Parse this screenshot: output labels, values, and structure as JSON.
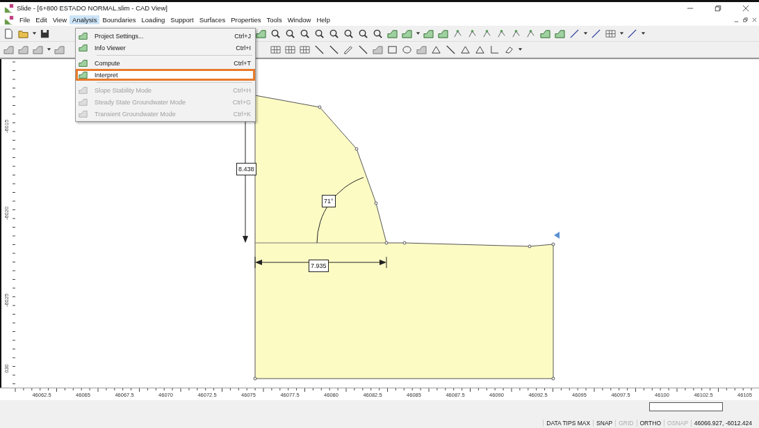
{
  "window": {
    "title": "Slide - [6+800 ESTADO NORMAL.slim - CAD View]"
  },
  "menu_bar": [
    {
      "label": "File",
      "selected": false
    },
    {
      "label": "Edit",
      "selected": false
    },
    {
      "label": "View",
      "selected": false
    },
    {
      "label": "Analysis",
      "selected": true
    },
    {
      "label": "Boundaries",
      "selected": false
    },
    {
      "label": "Loading",
      "selected": false
    },
    {
      "label": "Support",
      "selected": false
    },
    {
      "label": "Surfaces",
      "selected": false
    },
    {
      "label": "Properties",
      "selected": false
    },
    {
      "label": "Tools",
      "selected": false
    },
    {
      "label": "Window",
      "selected": false
    },
    {
      "label": "Help",
      "selected": false
    }
  ],
  "analysis_menu": [
    {
      "label": "Project Settings...",
      "shortcut": "Ctrl+J",
      "disabled": false,
      "highlighted": false,
      "separator_after": false
    },
    {
      "label": "Info Viewer",
      "shortcut": "Ctrl+I",
      "disabled": false,
      "highlighted": false,
      "separator_after": true
    },
    {
      "label": "Compute",
      "shortcut": "Ctrl+T",
      "disabled": false,
      "highlighted": false,
      "separator_after": false
    },
    {
      "label": "Interpret",
      "disabled": false,
      "highlighted": true,
      "separator_after": true
    },
    {
      "label": "Slope Stability Mode",
      "shortcut": "Ctrl+H",
      "disabled": true,
      "highlighted": false,
      "separator_after": false
    },
    {
      "label": "Steady State Groundwater Mode",
      "shortcut": "Ctrl+G",
      "disabled": true,
      "highlighted": false,
      "separator_after": false
    },
    {
      "label": "Transient Groundwater Mode",
      "shortcut": "Ctrl+K",
      "disabled": true,
      "highlighted": false,
      "separator_after": false
    }
  ],
  "canvas": {
    "height_dimension": "8.438",
    "width_dimension": "7.935",
    "angle": "71°"
  },
  "y_axis_labels": [
    "-6015",
    "-6020",
    "-6025",
    "030"
  ],
  "x_axis_labels": [
    "46062.5",
    "46065",
    "46067.5",
    "46070",
    "46072.5",
    "46075",
    "46077.5",
    "46080",
    "46082.5",
    "46085",
    "46087.5",
    "46090",
    "46092.5",
    "46095",
    "46097.5",
    "46100",
    "46102.5",
    "46105"
  ],
  "status_bar": {
    "items": [
      {
        "label": "DATA TIPS MAX",
        "on": true
      },
      {
        "label": "SNAP",
        "on": true
      },
      {
        "label": "GRID",
        "on": false
      },
      {
        "label": "ORTHO",
        "on": true
      },
      {
        "label": "OSNAP",
        "on": false
      }
    ],
    "coordinates": "46066.927,  -6012.424"
  }
}
